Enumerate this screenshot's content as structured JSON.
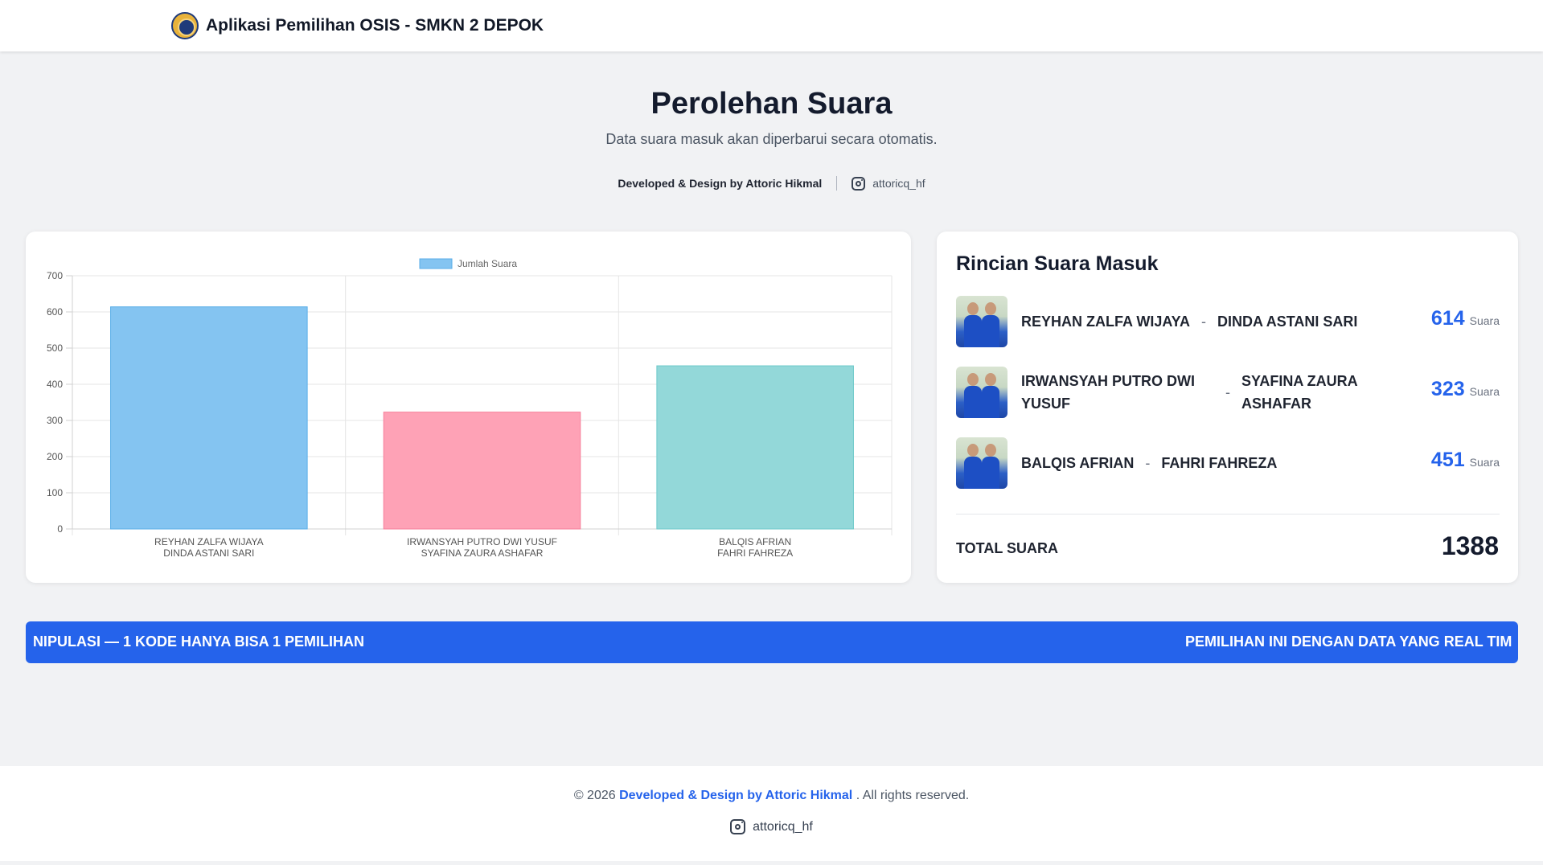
{
  "nav": {
    "title": "Aplikasi Pemilihan OSIS - SMKN 2 DEPOK"
  },
  "hero": {
    "title": "Perolehan Suara",
    "subtitle": "Data suara masuk akan diperbarui secara otomatis.",
    "credit": "Developed & Design by Attoric Hikmal",
    "instagram": "attoricq_hf"
  },
  "chart_data": {
    "type": "bar",
    "legend": "Jumlah Suara",
    "legend_position": "top-center",
    "categories": [
      [
        "REYHAN ZALFA WIJAYA",
        "DINDA ASTANI SARI"
      ],
      [
        "IRWANSYAH PUTRO DWI YUSUF",
        "SYAFINA ZAURA ASHAFAR"
      ],
      [
        "BALQIS AFRIAN",
        "FAHRI FAHREZA"
      ]
    ],
    "values": [
      614,
      323,
      451
    ],
    "colors": [
      "#84c4f1",
      "#fea2b6",
      "#93d8d9"
    ],
    "border_colors": [
      "#5aaee8",
      "#f77f99",
      "#6cc9ca"
    ],
    "ylim": [
      0,
      700
    ],
    "yticks": [
      "0",
      "100",
      "200",
      "300",
      "400",
      "500",
      "600",
      "700"
    ],
    "grid": true
  },
  "details": {
    "title": "Rincian Suara Masuk",
    "candidates": [
      {
        "name1": "REYHAN ZALFA WIJAYA",
        "name2": "DINDA ASTANI SARI",
        "votes": "614",
        "unit": "Suara"
      },
      {
        "name1": "IRWANSYAH PUTRO DWI YUSUF",
        "name2": "SYAFINA ZAURA ASHAFAR",
        "votes": "323",
        "unit": "Suara"
      },
      {
        "name1": "BALQIS AFRIAN",
        "name2": "FAHRI FAHREZA",
        "votes": "451",
        "unit": "Suara"
      }
    ],
    "separator": "-",
    "total_label": "TOTAL SUARA",
    "total_value": "1388"
  },
  "ticker": {
    "text_left": "NIPULASI — 1 KODE HANYA BISA 1 PEMILIHAN",
    "text_right": "PEMILIHAN INI DENGAN DATA YANG REAL TIM"
  },
  "footer": {
    "copyright": "© 2026",
    "brand": "Developed & Design by Attoric Hikmal",
    "rights": ". All rights reserved.",
    "instagram": "attoricq_hf"
  },
  "colors": {
    "accent": "#2563eb",
    "page_bg": "#f1f2f4"
  }
}
